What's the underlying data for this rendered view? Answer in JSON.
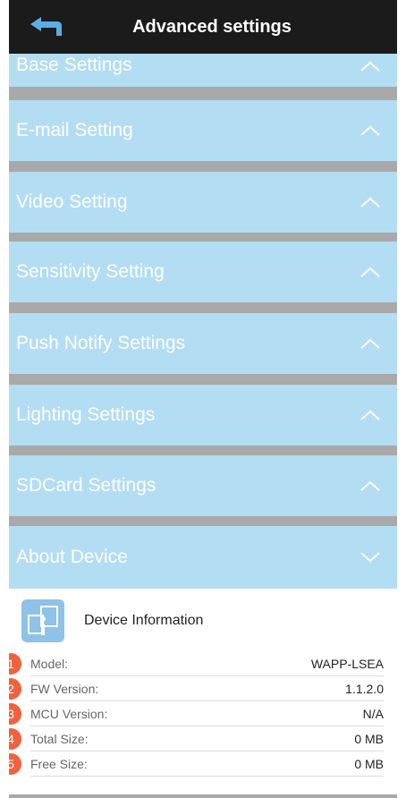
{
  "header": {
    "title": "Advanced settings",
    "back_icon": "back-arrow-icon"
  },
  "sections": [
    {
      "label": "Base Settings",
      "state": "up"
    },
    {
      "label": "E-mail Setting",
      "state": "up"
    },
    {
      "label": "Video Setting",
      "state": "up"
    },
    {
      "label": "Sensitivity Setting",
      "state": "up"
    },
    {
      "label": "Push Notify Settings",
      "state": "up"
    },
    {
      "label": "Lighting Settings",
      "state": "up"
    },
    {
      "label": "SDCard Settings",
      "state": "up"
    },
    {
      "label": "About Device",
      "state": "down"
    }
  ],
  "device_info": {
    "title": "Device Information",
    "icon": "device-info-icon",
    "rows": [
      {
        "num": "1",
        "label": "Model:",
        "value": "WAPP-LSEA"
      },
      {
        "num": "2",
        "label": "FW Version:",
        "value": "1.1.2.0"
      },
      {
        "num": "3",
        "label": "MCU Version:",
        "value": "N/A"
      },
      {
        "num": "4",
        "label": "Total Size:",
        "value": "0 MB"
      },
      {
        "num": "5",
        "label": "Free Size:",
        "value": "0 MB"
      }
    ]
  },
  "colors": {
    "header_bg": "#1b1b1b",
    "section_bg": "#b3ddf2",
    "separator": "#a9a9a9",
    "badge": "#f0623e"
  }
}
